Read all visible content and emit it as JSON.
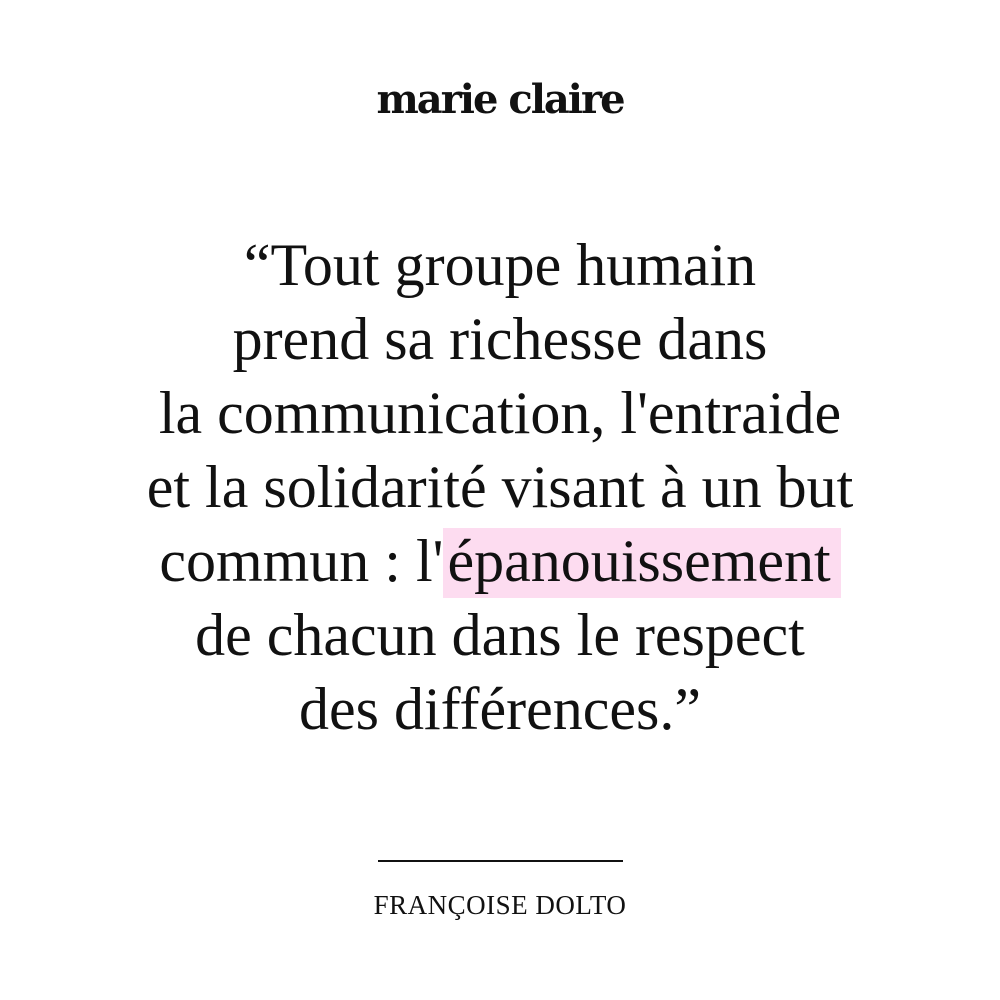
{
  "brand": {
    "logo_text": "marie claire"
  },
  "quote": {
    "line1": "“Tout groupe humain",
    "line2": "prend sa richesse dans",
    "line3": "la communication, l'entraide",
    "line4": "et la solidarité visant à un but",
    "line5_before": "commun : l'",
    "line5_highlight": "épanouissement",
    "line6": "de chacun dans le respect",
    "line7": "des différences.”",
    "highlight_color": "#fddcf0"
  },
  "author": {
    "name": "FRANÇOISE DOLTO"
  }
}
